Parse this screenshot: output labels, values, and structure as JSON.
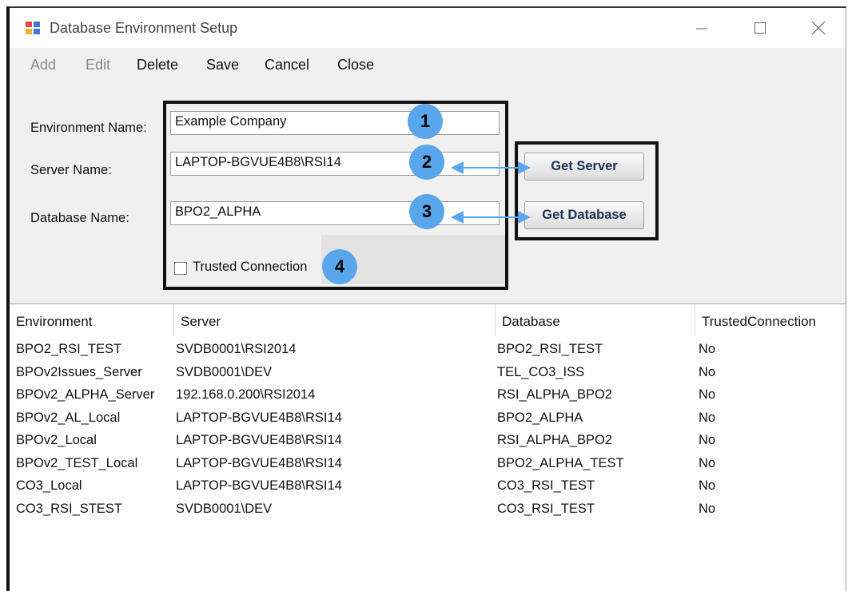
{
  "window": {
    "title": "Database Environment Setup"
  },
  "menu": [
    "Add",
    "Edit",
    "Delete",
    "Save",
    "Cancel",
    "Close"
  ],
  "form": {
    "environment_label": "Environment Name:",
    "environment_value": "Example Company",
    "server_label": "Server Name:",
    "server_value": "LAPTOP-BGVUE4B8\\RSI14",
    "database_label": "Database Name:",
    "database_value": "BPO2_ALPHA",
    "trusted_label": "Trusted Connection",
    "trusted_checked": false
  },
  "buttons": {
    "get_server": "Get Server",
    "get_database": "Get Database"
  },
  "callouts": [
    "1",
    "2",
    "3",
    "4"
  ],
  "grid": {
    "columns": [
      "Environment",
      "Server",
      "Database",
      "TrustedConnection"
    ],
    "rows": [
      [
        "BPO2_RSI_TEST",
        "SVDB0001\\RSI2014",
        "BPO2_RSI_TEST",
        "No"
      ],
      [
        "BPOv2Issues_Server",
        "SVDB0001\\DEV",
        "TEL_CO3_ISS",
        "No"
      ],
      [
        "BPOv2_ALPHA_Server",
        "192.168.0.200\\RSI2014",
        "RSI_ALPHA_BPO2",
        "No"
      ],
      [
        "BPOv2_AL_Local",
        "LAPTOP-BGVUE4B8\\RSI14",
        "BPO2_ALPHA",
        "No"
      ],
      [
        "BPOv2_Local",
        "LAPTOP-BGVUE4B8\\RSI14",
        "RSI_ALPHA_BPO2",
        "No"
      ],
      [
        "BPOv2_TEST_Local",
        "LAPTOP-BGVUE4B8\\RSI14",
        "BPO2_ALPHA_TEST",
        "No"
      ],
      [
        "CO3_Local",
        "LAPTOP-BGVUE4B8\\RSI14",
        "CO3_RSI_TEST",
        "No"
      ],
      [
        "CO3_RSI_STEST",
        "SVDB0001\\DEV",
        "CO3_RSI_TEST",
        "No"
      ]
    ]
  },
  "colors": {
    "callout": "#5aa6ec",
    "arrow": "#5aa6ec",
    "frame": "#111111",
    "button_text": "#1c2e52"
  },
  "icons": [
    "app-icon",
    "minimize-icon",
    "maximize-icon",
    "close-icon",
    "double-arrow-icon"
  ]
}
